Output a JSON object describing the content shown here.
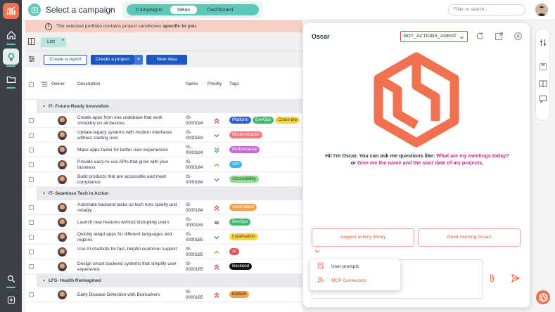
{
  "topbar": {
    "campaign_title": "Select a campaign",
    "tabs": [
      "Campaigns",
      "Ideas",
      "Dashboard"
    ],
    "active_tab": "Ideas",
    "filter_placeholder": "Filter or search..."
  },
  "banner": {
    "text_before": "The selected portfolio contains project sandboxes ",
    "text_bold": "specific to you",
    "text_after": "."
  },
  "list": {
    "tab_label": "List",
    "tab_marker": "*",
    "buttons": {
      "create_report": "Create a report",
      "create_project": "Create a project",
      "new_idea": "New idea"
    },
    "columns": {
      "owner": "Owner",
      "description": "Description",
      "name": "Name",
      "priority": "Priority",
      "tags": "Tags"
    },
    "groups": [
      {
        "title": "IT- Future-Ready Innovation",
        "rows": [
          {
            "desc": "Create apps from one codebase that work smoothly on all devices",
            "num": "IS-0000184",
            "priority": "high",
            "tags": [
              "Platform",
              "DevOps",
              "Cross-pla"
            ]
          },
          {
            "desc": "Update legacy systems with modern interfaces without starting over",
            "num": "IS-0000184",
            "priority": "low",
            "tags": [
              "Modernization"
            ]
          },
          {
            "desc": "Make apps faster for better user experiences",
            "num": "IS-0000184",
            "priority": "lowest",
            "tags": [
              "Performance"
            ]
          },
          {
            "desc": "Provide easy-to-use APIs that grow with your business",
            "num": "IS-0000184",
            "priority": "medium-high",
            "tags": [
              "API"
            ]
          },
          {
            "desc": "Build products that are accessible and meet compliance",
            "num": "IS-0000184",
            "priority": "low",
            "tags": [
              "Accessibility"
            ]
          }
        ]
      },
      {
        "title": "IT- Seamless Tech in Action",
        "rows": [
          {
            "desc": "Automate backend tasks so tech runs quietly and reliably",
            "num": "IS-0000184",
            "priority": "high",
            "tags": [
              "Automation"
            ]
          },
          {
            "desc": "Launch new features without disrupting users",
            "num": "IS-0000184",
            "priority": "medium",
            "tags": [
              "DevOps"
            ]
          },
          {
            "desc": "Quickly adapt apps for different languages and regions",
            "num": "IS-0000185",
            "priority": "low",
            "tags": [
              "Localisation"
            ]
          },
          {
            "desc": "Use AI chatbots for fast, helpful customer support",
            "num": "IS-0000185",
            "priority": "medium-high",
            "tags": [
              "AI"
            ]
          },
          {
            "desc": "Design smart backend systems that simplify user experience",
            "num": "IS-0000185",
            "priority": "high",
            "tags": [
              "Backend"
            ]
          }
        ]
      },
      {
        "title": "LFS- Health Reimagined",
        "rows": [
          {
            "desc": "Early Disease Detection with Biomarkers",
            "num": "IS-0000185",
            "priority": "high",
            "tags": [
              "biotech"
            ]
          }
        ]
      }
    ]
  },
  "tag_colors": {
    "Platform": {
      "bg": "#2f5fd0",
      "fg": "#ffffff"
    },
    "DevOps": {
      "bg": "#3cb96a",
      "fg": "#ffffff"
    },
    "Cross-pla": {
      "bg": "#f6d743",
      "fg": "#3b3b00"
    },
    "Modernization": {
      "bg": "#f07a7a",
      "fg": "#ffffff"
    },
    "Performance": {
      "bg": "#c76ad8",
      "fg": "#ffffff"
    },
    "API": {
      "bg": "#3fb6e8",
      "fg": "#ffffff"
    },
    "Accessibility": {
      "bg": "#8fdc8f",
      "fg": "#1f4d1f"
    },
    "Automation": {
      "bg": "#f4a04a",
      "fg": "#ffffff"
    },
    "Localisation": {
      "bg": "#f6d743",
      "fg": "#3b3b00"
    },
    "AI": {
      "bg": "#e05555",
      "fg": "#ffffff"
    },
    "Backend": {
      "bg": "#111111",
      "fg": "#ffffff"
    },
    "biotech": {
      "bg": "#f4a04a",
      "fg": "#3b2400"
    }
  },
  "oscar": {
    "title": "Oscar",
    "agent": "BOT_ACTIONS_AGENT",
    "greeting_lead": "Hi! I'm Oscar. You can ask me questions like: ",
    "greeting_q1": "What are my meetings today?",
    "greeting_mid": " or ",
    "greeting_q2": "Give me the name and the start date of my projects.",
    "suggestions": [
      "suggest activity library",
      "Good morning Oscar!"
    ],
    "menu": [
      "User prompts",
      "MCP Connectors"
    ]
  },
  "colors": {
    "accent_teal": "#5ec8b8",
    "brand_orange": "#ef7150",
    "primary_blue": "#1a56c4",
    "rail_dark": "#3b4049",
    "banner_bg": "#f7cfc4",
    "pink_link": "#d6238e"
  },
  "icons": [
    "app-logo-icon",
    "home-icon",
    "lightbulb-icon",
    "folder-icon",
    "search-icon",
    "add-icon",
    "refresh-icon",
    "open-external-icon",
    "close-icon",
    "attach-icon",
    "send-icon",
    "settings-icon",
    "save-icon",
    "book-icon",
    "comment-icon",
    "oscar-hex-icon"
  ]
}
